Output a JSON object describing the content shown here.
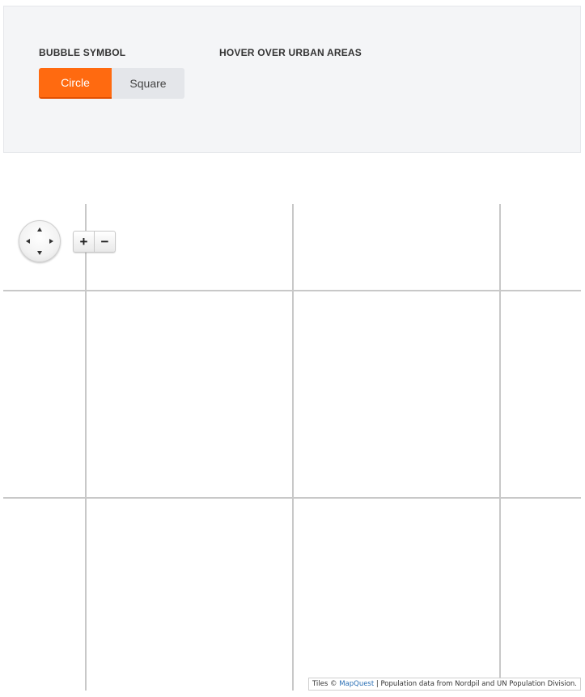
{
  "controls": {
    "bubble_symbol_label": "BUBBLE SYMBOL",
    "hover_label": "HOVER OVER URBAN AREAS",
    "options": [
      {
        "label": "Circle",
        "selected": true
      },
      {
        "label": "Square",
        "selected": false
      }
    ],
    "accent_color": "#ff6a10",
    "inactive_color": "#e4e6ea"
  },
  "map": {
    "pan_icon": "pan-arrows-icon",
    "zoom": {
      "in_label": "+",
      "out_label": "−"
    },
    "attribution": {
      "prefix": "Tiles © ",
      "link_text": "MapQuest",
      "suffix": " | Population data from Nordpil and UN Population Division."
    }
  }
}
